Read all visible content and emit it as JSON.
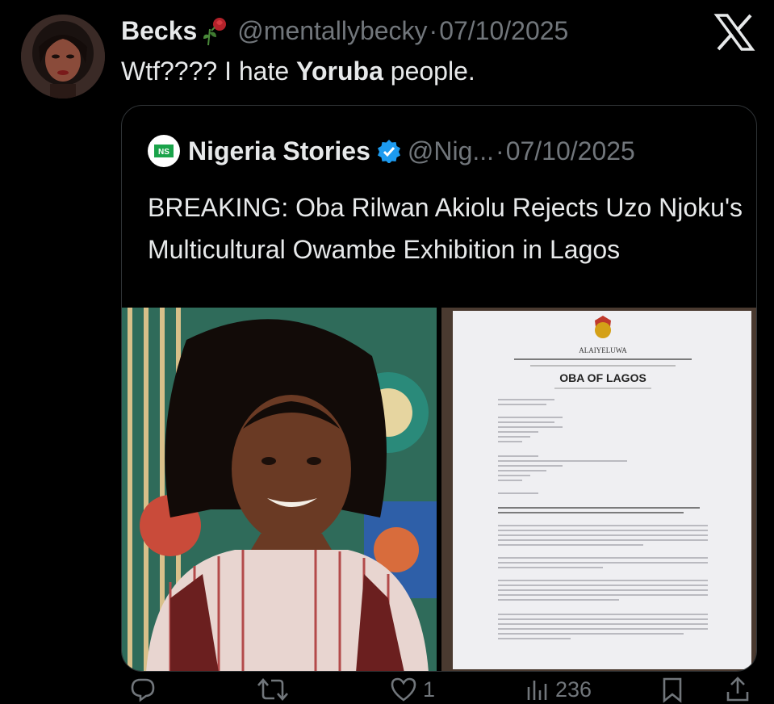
{
  "tweet": {
    "author_name": "Becks",
    "handle": "@mentallybecky",
    "separator": "·",
    "date": "07/10/2025",
    "text_before": "Wtf???? I hate ",
    "text_bold": "Yoruba",
    "text_after": " people."
  },
  "quote": {
    "author_name": "Nigeria Stories",
    "handle": "@Nig...",
    "separator": "·",
    "date": "07/10/2025",
    "text": "BREAKING: Oba Rilwan Akiolu Rejects Uzo Njoku's Multicultural Owambe Exhibition in Lagos",
    "letter": {
      "title": "ALAIYELUWA",
      "heading": "OBA OF LAGOS",
      "subject": "FORWARDING OF PETITION LETTER - REQUEST TO CANCEL \"AN OWAMBE EXHIBITION\" BY UZO NJOKU DUE TO CULTURAL MISREPRESENTATION"
    }
  },
  "actions": {
    "reply_count": "",
    "retweet_count": "",
    "like_count": "1",
    "views_count": "236"
  },
  "colors": {
    "background": "#000000",
    "text_primary": "#e7e9ea",
    "text_secondary": "#71767b",
    "border": "#2f3336",
    "verified": "#1d9bf0"
  },
  "icons": [
    "rose-icon",
    "x-logo-icon",
    "verified-badge-icon",
    "reply-icon",
    "retweet-icon",
    "like-icon",
    "views-icon",
    "bookmark-icon",
    "share-icon"
  ]
}
